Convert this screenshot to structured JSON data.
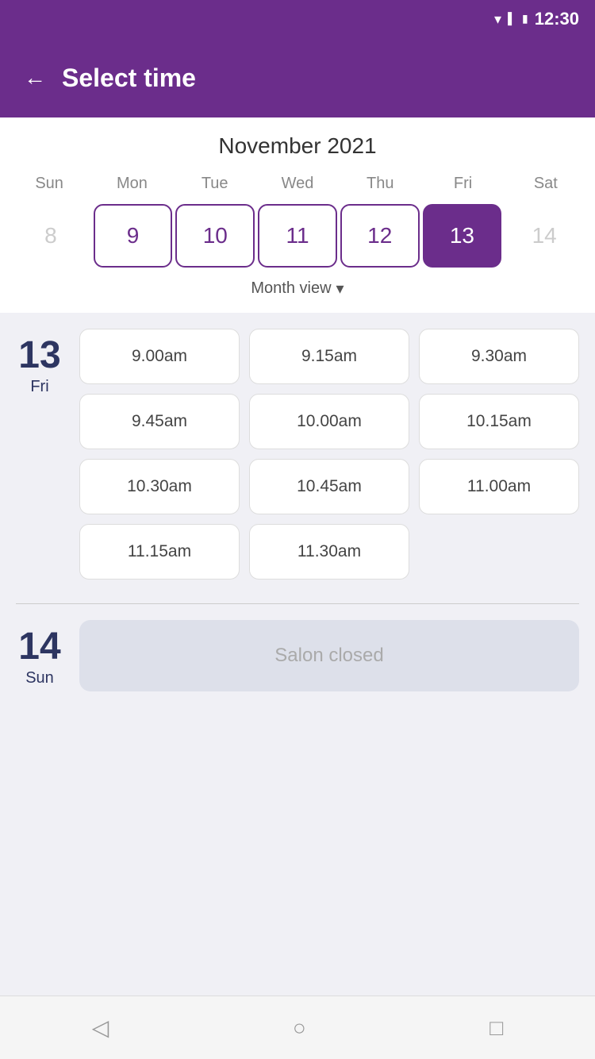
{
  "statusBar": {
    "time": "12:30"
  },
  "header": {
    "backLabel": "←",
    "title": "Select time"
  },
  "calendar": {
    "monthYear": "November 2021",
    "weekdays": [
      "Sun",
      "Mon",
      "Tue",
      "Wed",
      "Thu",
      "Fri",
      "Sat"
    ],
    "days": [
      {
        "num": "8",
        "state": "inactive"
      },
      {
        "num": "9",
        "state": "active"
      },
      {
        "num": "10",
        "state": "active"
      },
      {
        "num": "11",
        "state": "active"
      },
      {
        "num": "12",
        "state": "active"
      },
      {
        "num": "13",
        "state": "selected"
      },
      {
        "num": "14",
        "state": "inactive"
      }
    ],
    "monthViewLabel": "Month view"
  },
  "dayBlocks": [
    {
      "dayNumber": "13",
      "dayName": "Fri",
      "slots": [
        "9.00am",
        "9.15am",
        "9.30am",
        "9.45am",
        "10.00am",
        "10.15am",
        "10.30am",
        "10.45am",
        "11.00am",
        "11.15am",
        "11.30am"
      ],
      "closed": false
    },
    {
      "dayNumber": "14",
      "dayName": "Sun",
      "slots": [],
      "closed": true,
      "closedLabel": "Salon closed"
    }
  ],
  "navBar": {
    "back": "back",
    "home": "home",
    "recent": "recent"
  }
}
